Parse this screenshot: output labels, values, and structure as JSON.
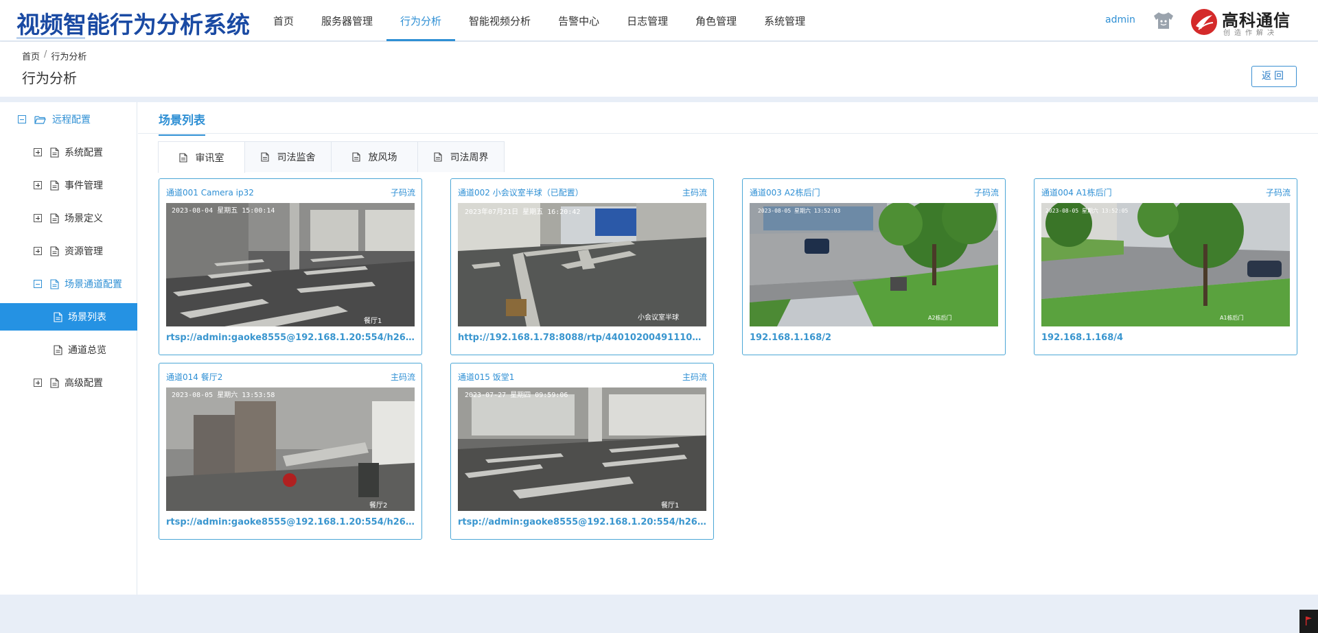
{
  "header": {
    "app_title": "视频智能行为分析系统",
    "nav": [
      "首页",
      "服务器管理",
      "行为分析",
      "智能视频分析",
      "告警中心",
      "日志管理",
      "角色管理",
      "系统管理"
    ],
    "active_nav": "行为分析",
    "user": "admin",
    "logo_text": "高科通信",
    "logo_sub": "创造作解决"
  },
  "breadcrumb": {
    "home": "首页",
    "sep": "/",
    "current": "行为分析"
  },
  "page_title": "行为分析",
  "back_label": "返回",
  "sidebar": {
    "root": "远程配置",
    "items": [
      "系统配置",
      "事件管理",
      "场景定义",
      "资源管理"
    ],
    "expanded": "场景通道配置",
    "children": [
      "场景列表",
      "通道总览"
    ],
    "last": "高级配置"
  },
  "section_tab": "场景列表",
  "scene_tabs": [
    "审讯室",
    "司法监舍",
    "放风场",
    "司法周界"
  ],
  "cards": [
    {
      "name": "通道001   Camera ip32",
      "stream": "子码流",
      "timestamp": "2023-08-04  星期五  15:00:14",
      "corner_label": "餐厅1",
      "url": "rtsp://admin:gaoke8555@192.168.1.20:554/h264/ch36..."
    },
    {
      "name": "通道002   小会议室半球（已配置）",
      "stream": "主码流",
      "timestamp": "2023年07月21日  星期五  16:20:42",
      "corner_label": "小会议室半球",
      "url": "http://192.168.1.78:8088/rtp/44010200491110000001_..."
    },
    {
      "name": "通道003   A2栋后门",
      "stream": "子码流",
      "timestamp": "2023-08-05  星期六  13:52:03",
      "corner_label": "A2栋后门",
      "url": "192.168.1.168/2"
    },
    {
      "name": "通道004   A1栋后门",
      "stream": "子码流",
      "timestamp": "2023-08-05  星期六  13:52:05",
      "corner_label": "A1栋后门",
      "url": "192.168.1.168/4"
    },
    {
      "name": "通道014   餐厅2",
      "stream": "主码流",
      "timestamp": "2023-08-05  星期六  13:53:58",
      "corner_label": "餐厅2",
      "url": "rtsp://admin:gaoke8555@192.168.1.20:554/h264/ch33..."
    },
    {
      "name": "通道015   饭堂1",
      "stream": "主码流",
      "timestamp": "2023-07-27  星期四  09:59:06",
      "corner_label": "餐厅1",
      "url": "rtsp://admin:gaoke8555@192.168.1.20:554/h264/ch36..."
    }
  ],
  "colors": {
    "accent": "#2e8fd4",
    "title": "#1a4aa3",
    "selected_bg": "#2592e3",
    "logo_red": "#d42a2a"
  },
  "icons": [
    "shirt-icon",
    "logo-mark",
    "folder-icon",
    "doc-icon",
    "flag-icon"
  ]
}
